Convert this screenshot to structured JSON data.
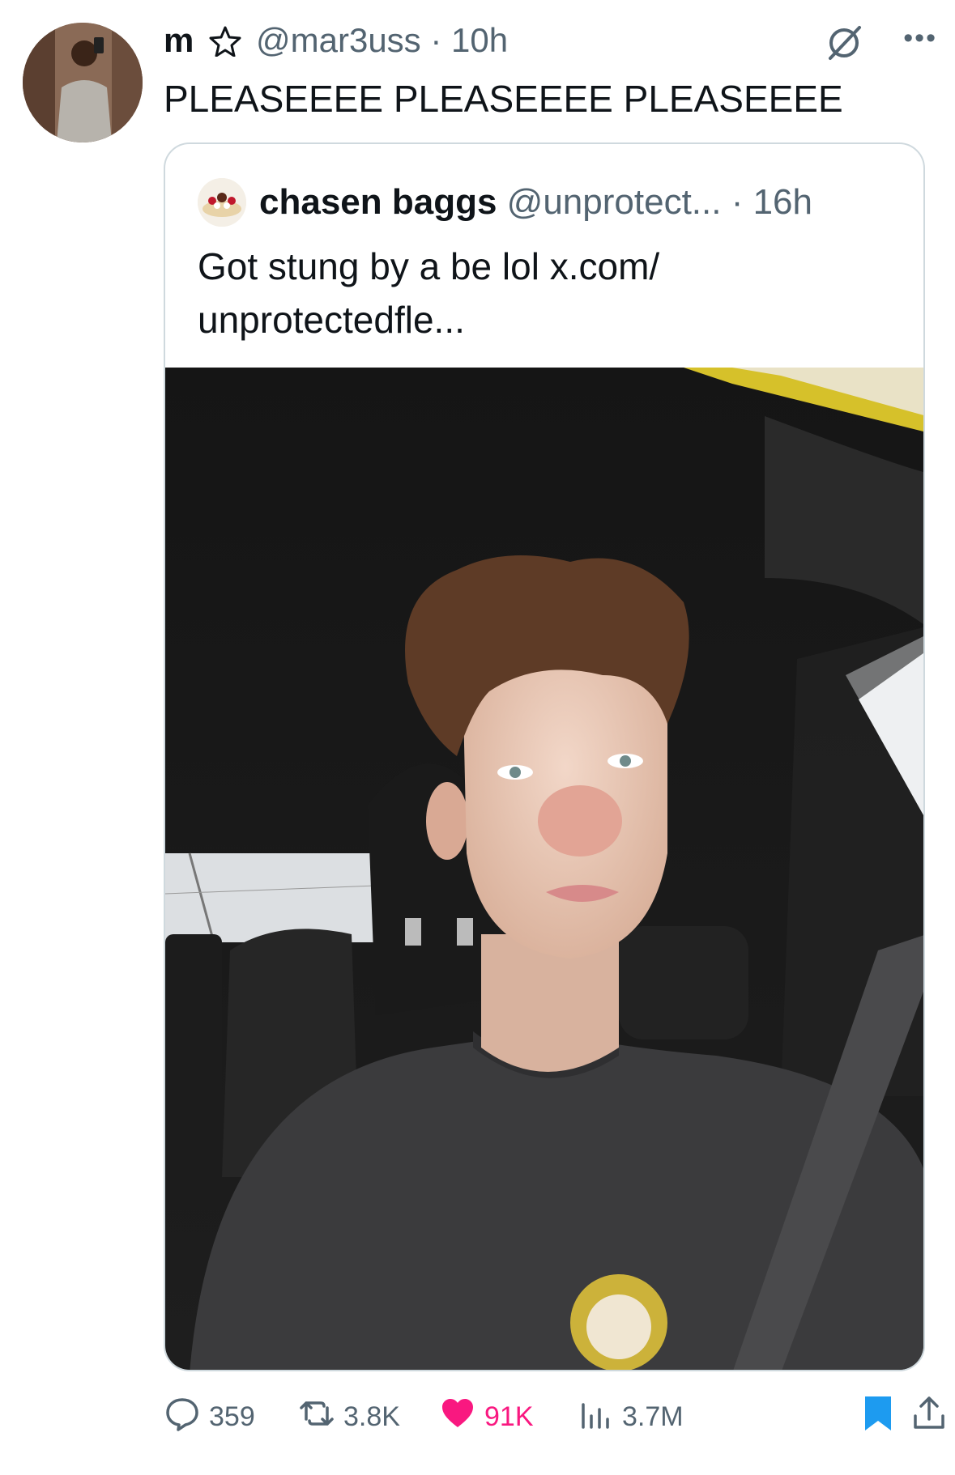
{
  "tweet": {
    "author_name": "m",
    "handle_and_time": "@mar3uss · 10h",
    "text": "PLEASEEEE PLEASEEEE PLEASEEEE",
    "more_label": "•••"
  },
  "quote": {
    "author_name": "chasen baggs",
    "handle_and_time": "@unprotect... · 16h",
    "text": "Got stung by a be lol x.com/ unprotectedfle..."
  },
  "actions": {
    "replies": "359",
    "retweets": "3.8K",
    "likes": "91K",
    "views": "3.7M"
  },
  "colors": {
    "like": "#f91880",
    "bookmark": "#1d9bf0",
    "secondary_text": "#536471",
    "border": "#cfd9de"
  }
}
